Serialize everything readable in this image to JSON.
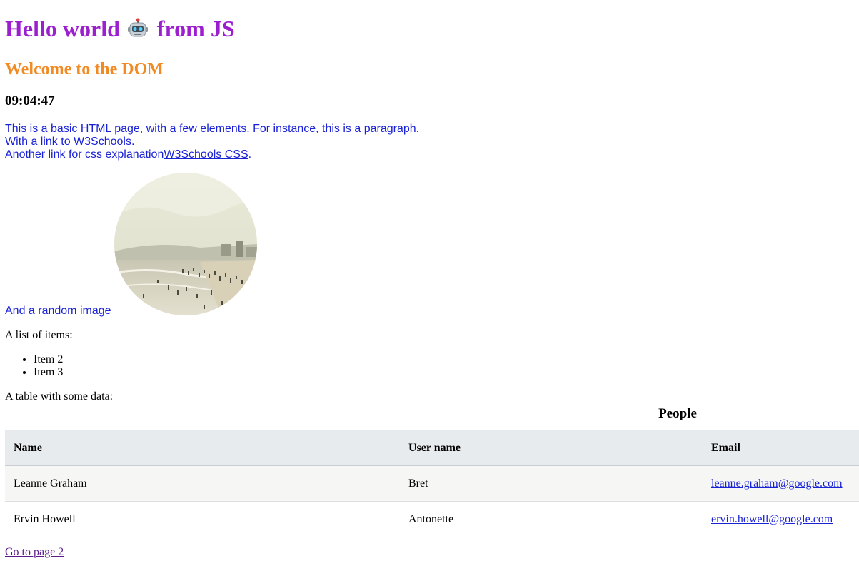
{
  "header": {
    "title_before": "Hello world",
    "title_after": "from JS",
    "subtitle": "Welcome to the DOM",
    "clock": "09:04:47"
  },
  "intro": {
    "line1": "This is a basic HTML page, with a few elements. For instance, this is a paragraph.",
    "line2_prefix": "With a link to ",
    "line2_link": "W3Schools",
    "line2_suffix": ".",
    "line3_prefix": "Another link for css explanation",
    "line3_link": "W3Schools CSS",
    "line3_suffix": "."
  },
  "image": {
    "caption": "And a random image",
    "icon": "beach-photo"
  },
  "list": {
    "label": "A list of items:",
    "items": [
      "Item 2",
      "Item 3"
    ]
  },
  "table": {
    "label": "A table with some data:",
    "caption": "People",
    "headers": [
      "Name",
      "User name",
      "Email"
    ],
    "rows": [
      [
        "Leanne Graham",
        "Bret",
        "leanne.graham@google.com"
      ],
      [
        "Ervin Howell",
        "Antonette",
        "ervin.howell@google.com"
      ]
    ]
  },
  "footer": {
    "link": "Go to page 2"
  },
  "colors": {
    "title": "#9b1fcf",
    "subtitle": "#f28a24",
    "paragraph": "#1a22d6",
    "visited_link": "#5a1a8a"
  }
}
